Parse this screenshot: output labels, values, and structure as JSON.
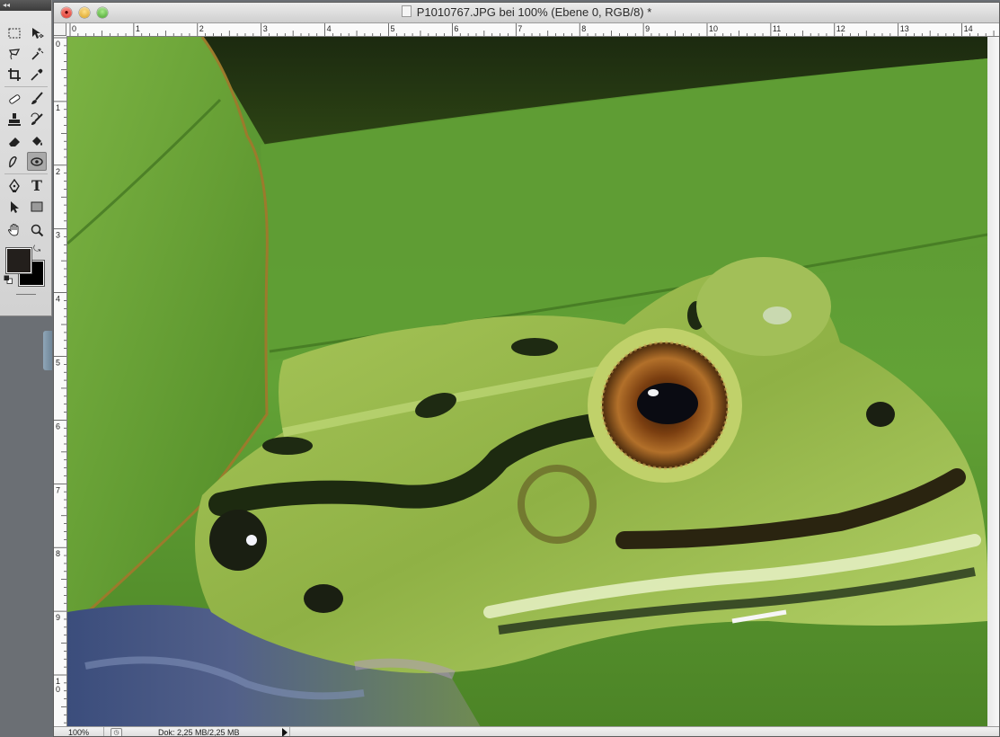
{
  "document": {
    "title": "P1010767.JPG bei 100% (Ebene 0, RGB/8) *"
  },
  "rulers": {
    "horizontal": [
      "0",
      "1",
      "2",
      "3",
      "4",
      "5",
      "6",
      "7",
      "8",
      "9",
      "10",
      "11",
      "12",
      "13",
      "14"
    ],
    "vertical": [
      "0",
      "1",
      "2",
      "3",
      "4",
      "5",
      "6",
      "7",
      "8",
      "9",
      "1\n0"
    ]
  },
  "status_bar": {
    "zoom": "100%",
    "doc_size": "Dok: 2,25 MB/2,25 MB"
  },
  "tools": [
    {
      "name": "rectangular-marquee-icon"
    },
    {
      "name": "move-icon"
    },
    {
      "name": "lasso-icon"
    },
    {
      "name": "magic-wand-icon"
    },
    {
      "name": "crop-icon"
    },
    {
      "name": "eyedropper-icon"
    },
    {
      "name": "healing-brush-icon"
    },
    {
      "name": "brush-icon"
    },
    {
      "name": "clone-stamp-icon"
    },
    {
      "name": "history-brush-icon"
    },
    {
      "name": "eraser-icon"
    },
    {
      "name": "paint-bucket-icon"
    },
    {
      "name": "smudge-icon"
    },
    {
      "name": "dodge-icon"
    },
    {
      "name": "pen-icon"
    },
    {
      "name": "type-icon"
    },
    {
      "name": "path-selection-icon"
    },
    {
      "name": "rectangle-shape-icon"
    },
    {
      "name": "hand-icon"
    },
    {
      "name": "zoom-icon"
    }
  ],
  "colors": {
    "foreground": "#231f1c",
    "background": "#000000"
  }
}
